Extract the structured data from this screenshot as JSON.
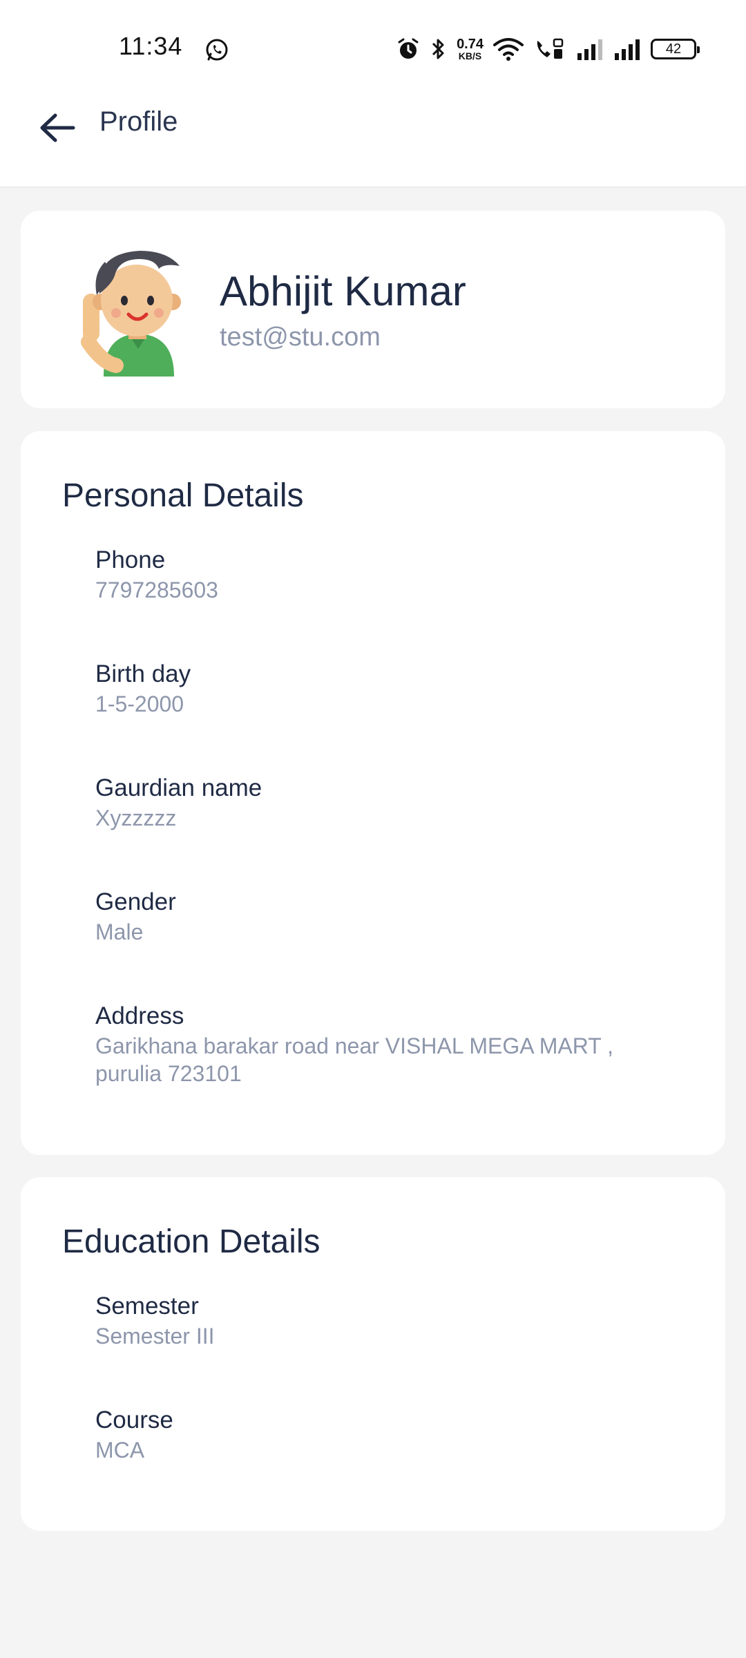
{
  "status_bar": {
    "time": "11:34",
    "net_speed_value": "0.74",
    "net_speed_unit": "KB/S",
    "battery": "42"
  },
  "app_bar": {
    "title": "Profile"
  },
  "profile": {
    "name": "Abhijit Kumar",
    "email": "test@stu.com"
  },
  "personal_details": {
    "title": "Personal Details",
    "fields": [
      {
        "label": "Phone",
        "value": "7797285603"
      },
      {
        "label": "Birth day",
        "value": "1-5-2000"
      },
      {
        "label": "Gaurdian name",
        "value": "Xyzzzzz"
      },
      {
        "label": "Gender",
        "value": "Male"
      },
      {
        "label": "Address",
        "value": "Garikhana barakar road near VISHAL MEGA MART , purulia 723101"
      }
    ]
  },
  "education_details": {
    "title": "Education Details",
    "fields": [
      {
        "label": "Semester",
        "value": "Semester III"
      },
      {
        "label": "Course",
        "value": "MCA"
      }
    ]
  }
}
